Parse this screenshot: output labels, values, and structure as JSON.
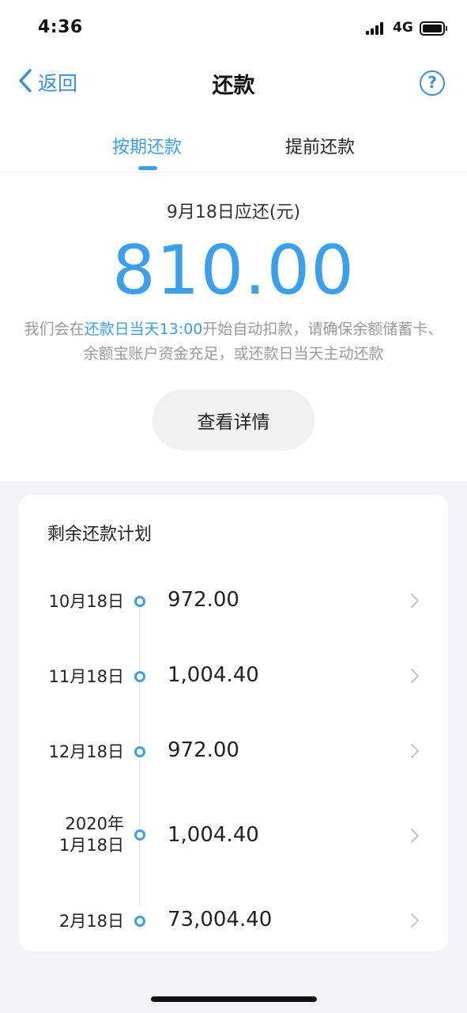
{
  "status_bar": {
    "time": "4:36",
    "network": "4G"
  },
  "nav": {
    "back_label": "返回",
    "title": "还款"
  },
  "tabs": [
    {
      "label": "按期还款",
      "active": true
    },
    {
      "label": "提前还款",
      "active": false
    }
  ],
  "due": {
    "label": "9月18日应还(元)",
    "amount": "810.00",
    "notice_prefix": "我们会在",
    "notice_highlight": "还款日当天13:00",
    "notice_rest": "开始自动扣款，请确保余额储蓄卡、余额宝账户资金充足，或还款日当天主动还款",
    "detail_button": "查看详情"
  },
  "plan": {
    "title": "剩余还款计划",
    "items": [
      {
        "date_line1": "10月18日",
        "date_line2": "",
        "amount": "972.00"
      },
      {
        "date_line1": "11月18日",
        "date_line2": "",
        "amount": "1,004.40"
      },
      {
        "date_line1": "12月18日",
        "date_line2": "",
        "amount": "972.00"
      },
      {
        "date_line1": "2020年",
        "date_line2": "1月18日",
        "amount": "1,004.40"
      },
      {
        "date_line1": "2月18日",
        "date_line2": "",
        "amount": "73,004.40"
      }
    ]
  },
  "colors": {
    "accent": "#3aa0ee",
    "link": "#3a8fe0",
    "text": "#222222",
    "muted": "#9a9a9a"
  }
}
